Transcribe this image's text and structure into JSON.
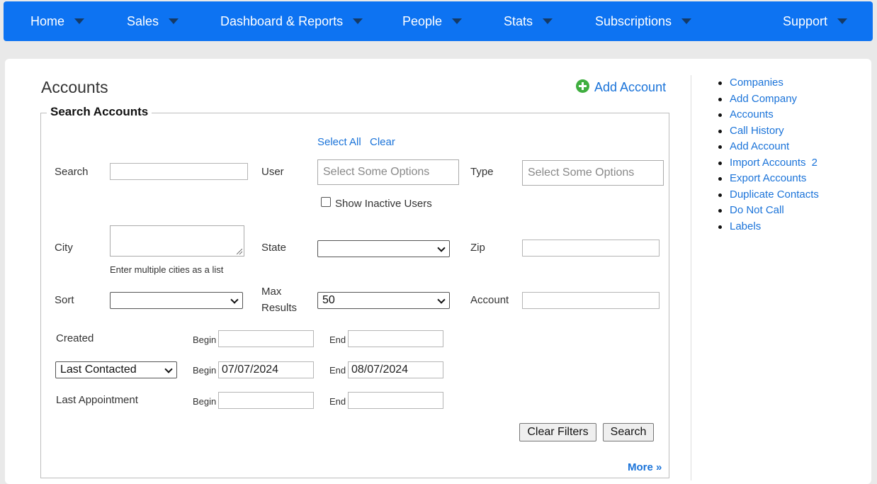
{
  "nav": {
    "items": [
      {
        "label": "Home"
      },
      {
        "label": "Sales"
      },
      {
        "label": "Dashboard & Reports"
      },
      {
        "label": "People"
      },
      {
        "label": "Stats"
      },
      {
        "label": "Subscriptions"
      },
      {
        "label": "Support"
      }
    ]
  },
  "page": {
    "title": "Accounts",
    "add_account": "Add Account"
  },
  "search": {
    "legend": "Search Accounts",
    "select_all": "Select All",
    "clear": "Clear",
    "search_label": "Search",
    "search_value": "",
    "user_label": "User",
    "user_placeholder": "Select Some Options",
    "type_label": "Type",
    "type_placeholder": "Select Some Options",
    "show_inactive_label": "Show Inactive Users",
    "city_label": "City",
    "city_help": "Enter multiple cities as a list",
    "state_label": "State",
    "state_value": "",
    "zip_label": "Zip",
    "zip_value": "",
    "sort_label": "Sort",
    "sort_value": "",
    "max_results_label_1": "Max",
    "max_results_label_2": "Results",
    "max_results_value": "50",
    "account_label": "Account",
    "account_value": "",
    "created_label": "Created",
    "begin_label": "Begin",
    "end_label": "End",
    "created_begin": "",
    "created_end": "",
    "last_contacted_value": "Last Contacted",
    "last_contacted_begin": "07/07/2024",
    "last_contacted_end": "08/07/2024",
    "last_appointment_label": "Last Appointment",
    "last_appointment_begin": "",
    "last_appointment_end": "",
    "clear_filters": "Clear Filters",
    "search_button": "Search",
    "more": "More »"
  },
  "sidebar": {
    "items": [
      {
        "label": "Companies",
        "badge": ""
      },
      {
        "label": "Add Company",
        "badge": ""
      },
      {
        "label": "Accounts",
        "badge": ""
      },
      {
        "label": "Call History",
        "badge": ""
      },
      {
        "label": "Add Account",
        "badge": ""
      },
      {
        "label": "Import Accounts",
        "badge": "2"
      },
      {
        "label": "Export Accounts",
        "badge": ""
      },
      {
        "label": "Duplicate Contacts",
        "badge": ""
      },
      {
        "label": "Do Not Call",
        "badge": ""
      },
      {
        "label": "Labels",
        "badge": ""
      }
    ]
  },
  "colors": {
    "nav_bg": "#0d73f2",
    "link": "#1a73d9",
    "add_icon": "#3fae3f"
  }
}
